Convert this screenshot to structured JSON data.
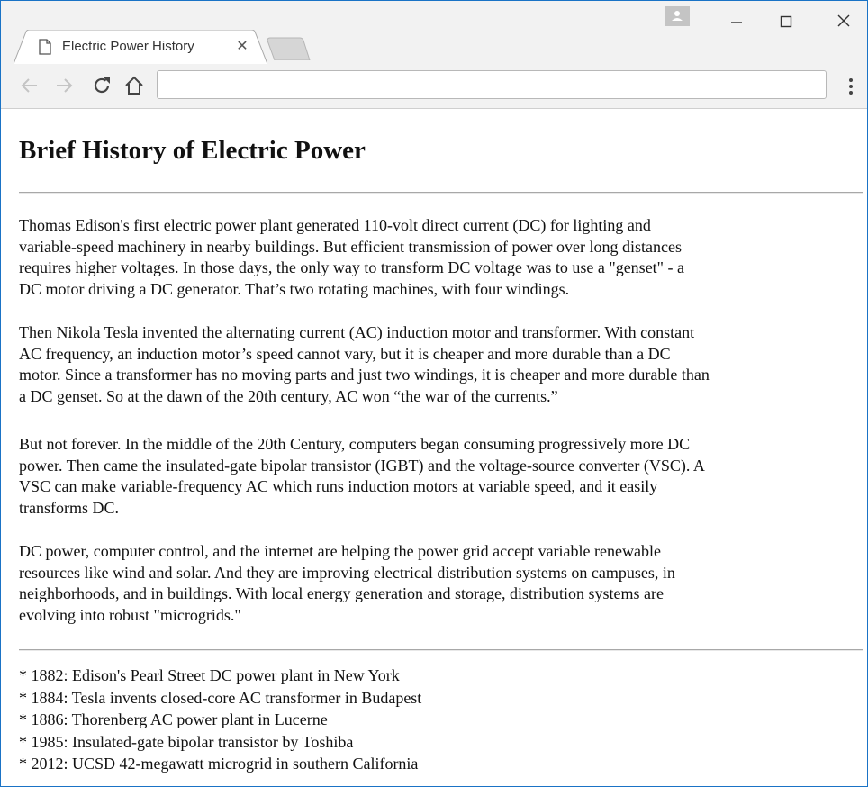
{
  "browser": {
    "tab": {
      "title": "Electric Power History",
      "close_glyph": "✕"
    },
    "address_bar": {
      "value": "",
      "placeholder": ""
    },
    "icons": {
      "back": "arrow-left-icon",
      "forward": "arrow-right-icon",
      "reload": "reload-icon",
      "home": "home-icon",
      "menu": "kebab-menu-icon",
      "page": "page-icon",
      "profile": "profile-icon",
      "minimize": "minimize-icon",
      "maximize": "maximize-icon",
      "close": "close-icon"
    },
    "colors": {
      "frame_border": "#1a73c6",
      "chrome_bg": "#f2f2f2"
    }
  },
  "page": {
    "heading": "Brief History of Electric Power",
    "paragraphs": [
      [
        "Thomas Edison's first electric power plant generated 110-volt direct current (DC) for lighting and",
        "variable-speed machinery in nearby buildings. But efficient transmission of power over long distances",
        "requires higher voltages. In those days, the only way to transform DC voltage was to use a \"genset\" - a",
        "DC motor driving a DC generator. That’s two rotating machines, with four windings."
      ],
      [
        "Then Nikola Tesla invented the alternating current (AC) induction motor and transformer. With constant",
        "AC frequency, an induction motor’s speed cannot vary, but it is cheaper and more durable than a DC",
        "motor. Since a transformer has no moving parts and just two windings, it is cheaper and more durable than",
        "a DC genset. So at the dawn of the 20th century, AC won “the war of the currents.”"
      ],
      [
        "But not forever. In the middle of the 20th Century, computers began consuming progressively more DC",
        "power. Then came the insulated-gate bipolar transistor (IGBT) and the voltage-source converter (VSC). A",
        "VSC can make variable-frequency AC which runs induction motors at variable speed, and it easily",
        "transforms DC."
      ],
      [
        "DC power, computer control, and the internet are helping the power grid accept variable renewable",
        "resources like wind and solar. And they are improving electrical distribution systems on campuses, in",
        "neighborhoods, and in buildings. With local energy generation and storage, distribution systems are",
        "evolving into robust \"microgrids.\""
      ]
    ],
    "timeline": [
      "* 1882: Edison's Pearl Street DC power plant in New York",
      "* 1884: Tesla invents closed-core AC transformer in Budapest",
      "* 1886: Thorenberg AC power plant in Lucerne",
      "* 1985: Insulated-gate bipolar transistor by Toshiba",
      "* 2012: UCSD 42-megawatt microgrid in southern California"
    ]
  }
}
